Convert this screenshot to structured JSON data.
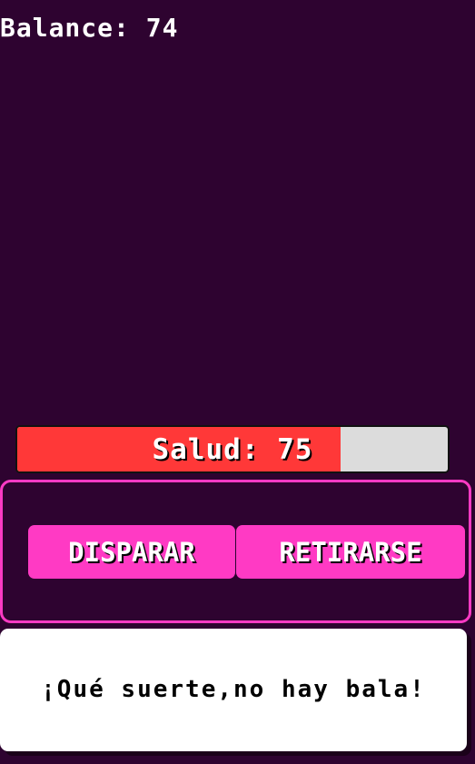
{
  "status": {
    "balance_text": "Balance: 74"
  },
  "health": {
    "label": "Salud: 75",
    "value": 75,
    "max": 100,
    "fill_color": "#ff3838",
    "empty_color": "#dcdcdc"
  },
  "actions": {
    "fire_label": "DISPARAR",
    "retire_label": "RETIRARSE",
    "accent_color": "#ff3ac4"
  },
  "message": {
    "text": "¡Qué suerte,no hay bala!"
  },
  "theme": {
    "background": "#2e0330"
  }
}
